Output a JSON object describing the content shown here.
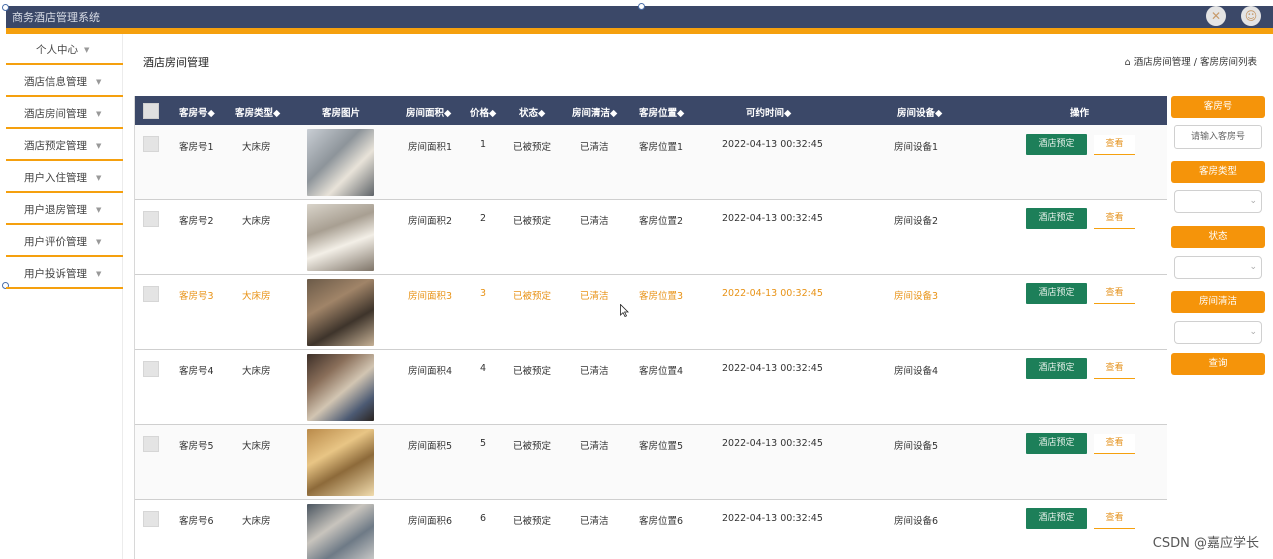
{
  "app": {
    "title": "商务酒店管理系统",
    "close_icon": "close-icon",
    "user_icon": "user-icon"
  },
  "sidebar": {
    "items": [
      {
        "label": "个人中心"
      },
      {
        "label": "酒店信息管理"
      },
      {
        "label": "酒店房间管理"
      },
      {
        "label": "酒店预定管理"
      },
      {
        "label": "用户入住管理"
      },
      {
        "label": "用户退房管理"
      },
      {
        "label": "用户评价管理"
      },
      {
        "label": "用户投诉管理"
      }
    ]
  },
  "page": {
    "title": "酒店房间管理",
    "breadcrumb": {
      "level1": "酒店房间管理",
      "sep": "/",
      "level2": "客房房间列表"
    }
  },
  "table": {
    "columns": {
      "room_no": "客房号◆",
      "room_type": "客房类型◆",
      "photo": "客房图片",
      "area": "房间面积◆",
      "price": "价格◆",
      "status": "状态◆",
      "clean": "房间清洁◆",
      "location": "客房位置◆",
      "time": "可约时间◆",
      "equip": "房间设备◆",
      "actions": "操作"
    },
    "rows": [
      {
        "room_no": "客房号1",
        "room_type": "大床房",
        "area": "房间面积1",
        "price": "1",
        "status": "已被预定",
        "clean": "已清洁",
        "location": "客房位置1",
        "time": "2022-04-13 00:32:45",
        "equip": "房间设备1",
        "book": "酒店预定",
        "view": "查看"
      },
      {
        "room_no": "客房号2",
        "room_type": "大床房",
        "area": "房间面积2",
        "price": "2",
        "status": "已被预定",
        "clean": "已清洁",
        "location": "客房位置2",
        "time": "2022-04-13 00:32:45",
        "equip": "房间设备2",
        "book": "酒店预定",
        "view": "查看"
      },
      {
        "room_no": "客房号3",
        "room_type": "大床房",
        "area": "房间面积3",
        "price": "3",
        "status": "已被预定",
        "clean": "已清洁",
        "location": "客房位置3",
        "time": "2022-04-13 00:32:45",
        "equip": "房间设备3",
        "book": "酒店预定",
        "view": "查看"
      },
      {
        "room_no": "客房号4",
        "room_type": "大床房",
        "area": "房间面积4",
        "price": "4",
        "status": "已被预定",
        "clean": "已清洁",
        "location": "客房位置4",
        "time": "2022-04-13 00:32:45",
        "equip": "房间设备4",
        "book": "酒店预定",
        "view": "查看"
      },
      {
        "room_no": "客房号5",
        "room_type": "大床房",
        "area": "房间面积5",
        "price": "5",
        "status": "已被预定",
        "clean": "已清洁",
        "location": "客房位置5",
        "time": "2022-04-13 00:32:45",
        "equip": "房间设备5",
        "book": "酒店预定",
        "view": "查看"
      },
      {
        "room_no": "客房号6",
        "room_type": "大床房",
        "area": "房间面积6",
        "price": "6",
        "status": "已被预定",
        "clean": "已清洁",
        "location": "客房位置6",
        "time": "2022-04-13 00:32:45",
        "equip": "房间设备6",
        "book": "酒店预定",
        "view": "查看"
      }
    ]
  },
  "filter": {
    "room_no_label": "客房号",
    "room_no_placeholder": "请输入客房号",
    "room_type_label": "客房类型",
    "status_label": "状态",
    "clean_label": "房间清洁",
    "query_label": "查询"
  },
  "watermark": "CSDN @嘉应学长",
  "colors": {
    "header": "#3b4868",
    "accent": "#f5a00e",
    "book_button": "#1d7f59",
    "highlight_text": "#e89317"
  }
}
